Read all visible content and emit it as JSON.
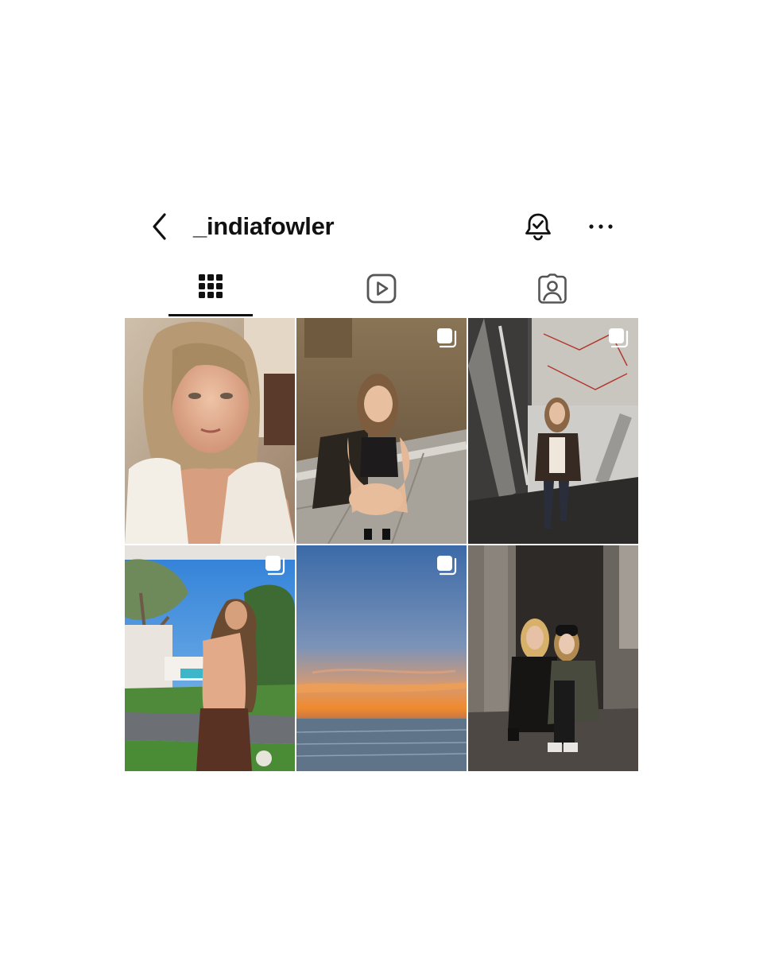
{
  "header": {
    "username": "_indiafowler",
    "back_icon": "chevron-left-icon",
    "notify_icon": "bell-check-icon",
    "more_icon": "more-horizontal-icon"
  },
  "tabs": [
    {
      "name": "posts",
      "icon": "grid-icon",
      "active": true
    },
    {
      "name": "reels",
      "icon": "reels-play-icon",
      "active": false
    },
    {
      "name": "tagged",
      "icon": "tagged-person-icon",
      "active": false
    }
  ],
  "posts": [
    {
      "subject": "selfie-white-blouse",
      "multi": false
    },
    {
      "subject": "crouching-night-pavement",
      "multi": true
    },
    {
      "subject": "train-door-standing",
      "multi": true
    },
    {
      "subject": "garden-backless-top",
      "multi": true
    },
    {
      "subject": "ocean-sunset",
      "multi": true
    },
    {
      "subject": "two-friends-street-night",
      "multi": false
    }
  ],
  "colors": {
    "text": "#111111",
    "background": "#ffffff",
    "tab_indicator": "#111111"
  }
}
